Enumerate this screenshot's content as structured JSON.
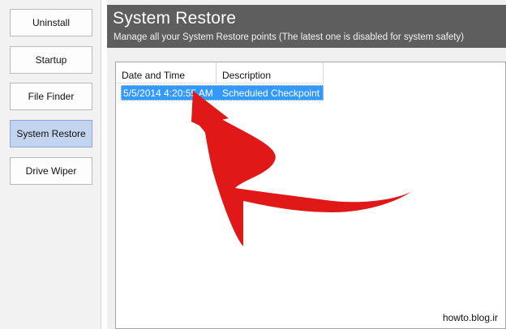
{
  "sidebar": {
    "items": [
      {
        "label": "Uninstall"
      },
      {
        "label": "Startup"
      },
      {
        "label": "File Finder"
      },
      {
        "label": "System Restore"
      },
      {
        "label": "Drive Wiper"
      }
    ]
  },
  "header": {
    "title": "System Restore",
    "subtitle": "Manage all your System Restore points (The latest one is disabled for system safety)"
  },
  "list": {
    "columns": [
      "Date and Time",
      "Description"
    ],
    "rows": [
      {
        "date": "5/5/2014 4:20:55 AM",
        "description": "Scheduled Checkpoint"
      }
    ]
  },
  "annotation": {
    "arrow_color": "#e01818"
  },
  "colors": {
    "header_bg": "#5e5e5e",
    "selection": "#3399ff",
    "active_nav": "#c3d4ef"
  },
  "watermark": "howto.blog.ir"
}
